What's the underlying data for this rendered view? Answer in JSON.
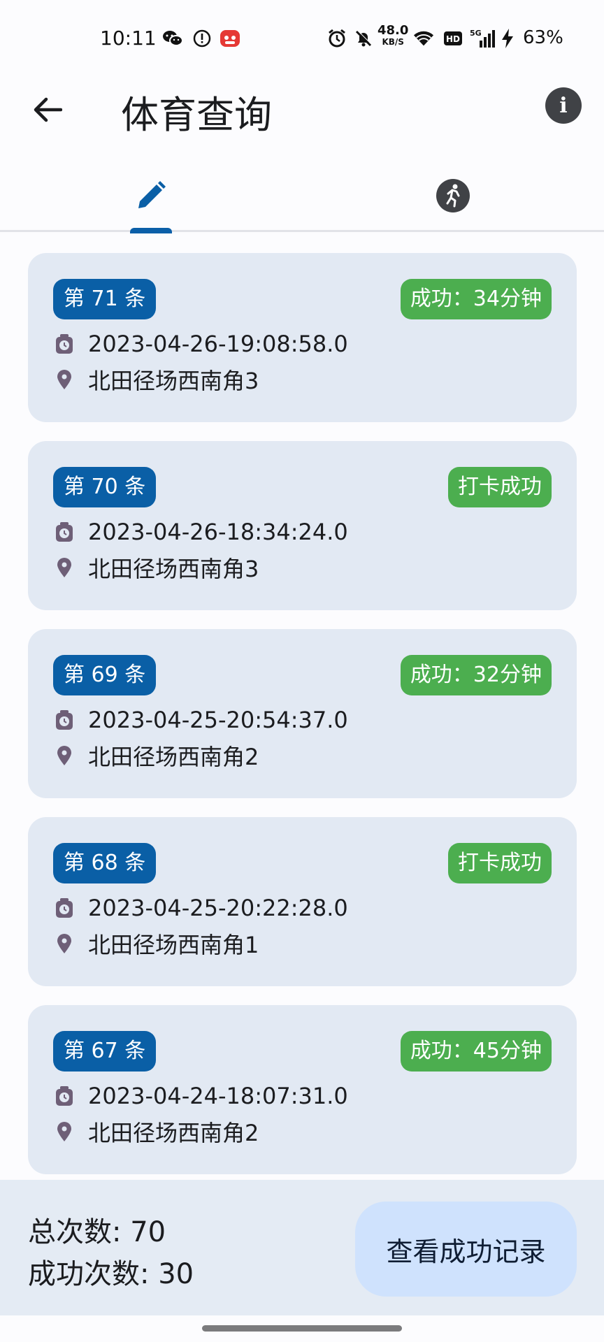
{
  "status_bar": {
    "time": "10:11",
    "net_speed_value": "48.0",
    "net_speed_unit": "KB/S",
    "network": "5G",
    "battery": "63%",
    "icons": [
      "wechat-icon",
      "alert-circle-icon",
      "app-notification-icon",
      "alarm-icon",
      "mute-bell-icon",
      "wifi-icon",
      "hd-icon",
      "signal-icon",
      "charging-icon"
    ]
  },
  "appbar": {
    "title": "体育查询",
    "back_icon": "arrow-left-icon",
    "info_icon": "info-icon"
  },
  "tabs": [
    {
      "icon": "pencil-icon",
      "selected": true
    },
    {
      "icon": "running-icon",
      "selected": false
    }
  ],
  "records": [
    {
      "number": "第 71 条",
      "status": "成功：34分钟",
      "time": "2023-04-26-19:08:58.0",
      "location": "北田径场西南角3"
    },
    {
      "number": "第 70 条",
      "status": "打卡成功",
      "time": "2023-04-26-18:34:24.0",
      "location": "北田径场西南角3"
    },
    {
      "number": "第 69 条",
      "status": "成功：32分钟",
      "time": "2023-04-25-20:54:37.0",
      "location": "北田径场西南角2"
    },
    {
      "number": "第 68 条",
      "status": "打卡成功",
      "time": "2023-04-25-20:22:28.0",
      "location": "北田径场西南角1"
    },
    {
      "number": "第 67 条",
      "status": "成功：45分钟",
      "time": "2023-04-24-18:07:31.0",
      "location": "北田径场西南角2"
    }
  ],
  "footer": {
    "total": "总次数: 70",
    "success": "成功次数: 30",
    "view_button": "查看成功记录"
  },
  "colors": {
    "primary": "#0a5fa6",
    "success": "#4cae4f",
    "card_bg": "#e2e9f3",
    "button_bg": "#cfe2fd",
    "icon_purple": "#6e5f77"
  }
}
